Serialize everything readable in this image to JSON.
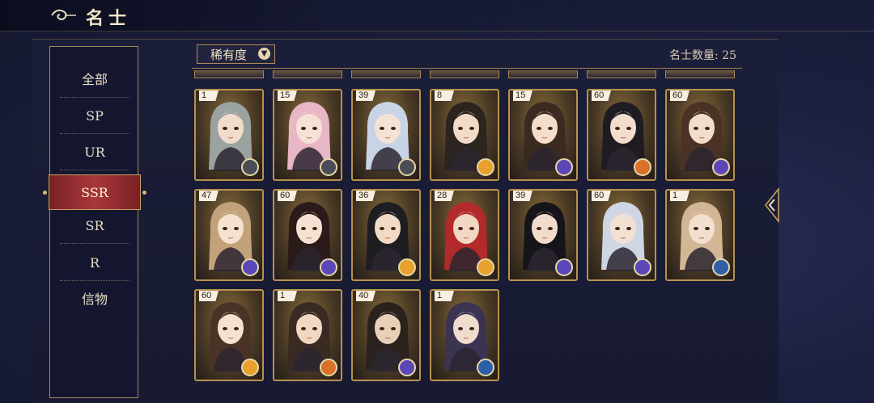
{
  "header": {
    "title": "名士"
  },
  "sidebar": {
    "items": [
      {
        "label": "全部"
      },
      {
        "label": "SP"
      },
      {
        "label": "UR"
      },
      {
        "label": "SSR"
      },
      {
        "label": "SR"
      },
      {
        "label": "R"
      },
      {
        "label": "信物"
      }
    ],
    "active_index": 3
  },
  "toolbar": {
    "sort_label": "稀有度",
    "count_text": "名士数量: 25"
  },
  "colors": {
    "gold": "#b8924f",
    "active_tab": "#a8373a",
    "elem_gold": "#e7a12c",
    "elem_purple": "#5b47b8",
    "elem_blue": "#2e5fa8",
    "elem_grey": "#4a4d55",
    "elem_orange": "#d9712a"
  },
  "cards": [
    {
      "level": "1",
      "hair": "#9aa3a0",
      "skin": "#f1dccb",
      "element": "elem_grey"
    },
    {
      "level": "15",
      "hair": "#e8b7c6",
      "skin": "#f6e1d7",
      "element": "elem_grey"
    },
    {
      "level": "39",
      "hair": "#c9d3e6",
      "skin": "#f3e3d6",
      "element": "elem_grey"
    },
    {
      "level": "8",
      "hair": "#2b241f",
      "skin": "#f2dcc8",
      "element": "elem_gold"
    },
    {
      "level": "15",
      "hair": "#3a2a20",
      "skin": "#f4ddcb",
      "element": "elem_purple"
    },
    {
      "level": "60",
      "hair": "#1f1b22",
      "skin": "#f3dccb",
      "element": "elem_orange"
    },
    {
      "level": "60",
      "hair": "#4a3226",
      "skin": "#f4dccb",
      "element": "elem_purple"
    },
    {
      "level": "47",
      "hair": "#c2a27a",
      "skin": "#f4e1d0",
      "element": "elem_purple"
    },
    {
      "level": "60",
      "hair": "#2a1a1a",
      "skin": "#f6e0d2",
      "element": "elem_purple"
    },
    {
      "level": "36",
      "hair": "#1e1d22",
      "skin": "#f2dac6",
      "element": "elem_gold"
    },
    {
      "level": "28",
      "hair": "#b22a2a",
      "skin": "#f2d8c4",
      "element": "elem_gold"
    },
    {
      "level": "39",
      "hair": "#15141a",
      "skin": "#f1dccb",
      "element": "elem_purple"
    },
    {
      "level": "60",
      "hair": "#cfd6e3",
      "skin": "#f2e0d3",
      "element": "elem_purple"
    },
    {
      "level": "1",
      "hair": "#d2b796",
      "skin": "#f3dfce",
      "element": "elem_blue"
    },
    {
      "level": "60",
      "hair": "#4a3326",
      "skin": "#f6e1d1",
      "element": "elem_gold"
    },
    {
      "level": "1",
      "hair": "#3a2b22",
      "skin": "#f0d8c3",
      "element": "elem_orange"
    },
    {
      "level": "40",
      "hair": "#2b221e",
      "skin": "#e8cfb8",
      "element": "elem_purple"
    },
    {
      "level": "1",
      "hair": "#3b3352",
      "skin": "#efdccd",
      "element": "elem_blue"
    }
  ]
}
